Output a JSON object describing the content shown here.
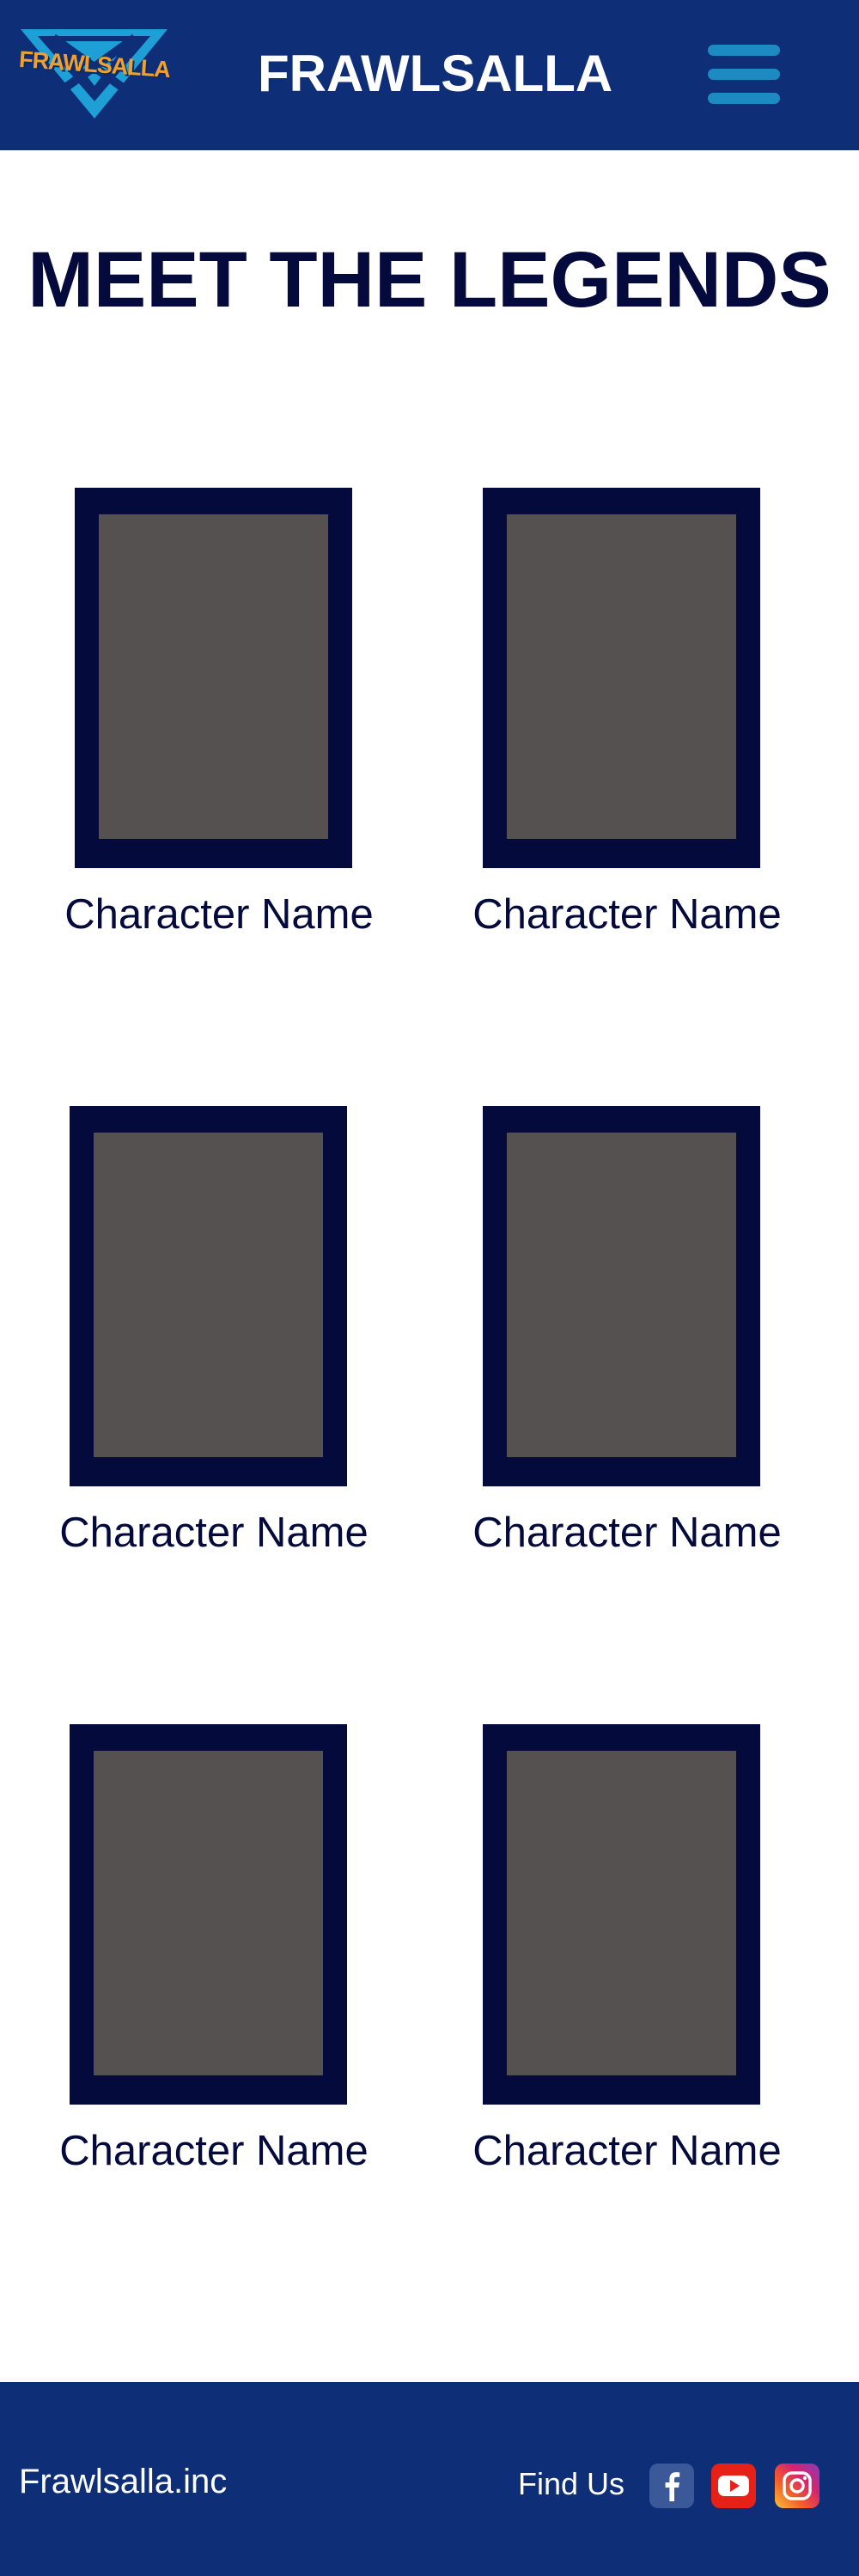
{
  "header": {
    "logo_text": "FRAWLSALLA",
    "brand": "FRAWLSALLA",
    "menu_icon": "hamburger-menu-icon"
  },
  "main": {
    "title": "MEET THE LEGENDS",
    "characters": [
      {
        "name": "Character Name"
      },
      {
        "name": "Character Name"
      },
      {
        "name": "Character Name"
      },
      {
        "name": "Character Name"
      },
      {
        "name": "Character Name"
      },
      {
        "name": "Character Name"
      }
    ]
  },
  "footer": {
    "brand": "Frawlsalla.inc",
    "find_us": "Find Us",
    "social": [
      "facebook-icon",
      "youtube-icon",
      "instagram-icon"
    ]
  },
  "colors": {
    "header_bg": "#0f2e78",
    "title": "#050a3c",
    "frame": "#050a3c",
    "portrait": "#555150",
    "menu_accent": "#1e8ac2",
    "logo_accent": "#f0a030"
  }
}
